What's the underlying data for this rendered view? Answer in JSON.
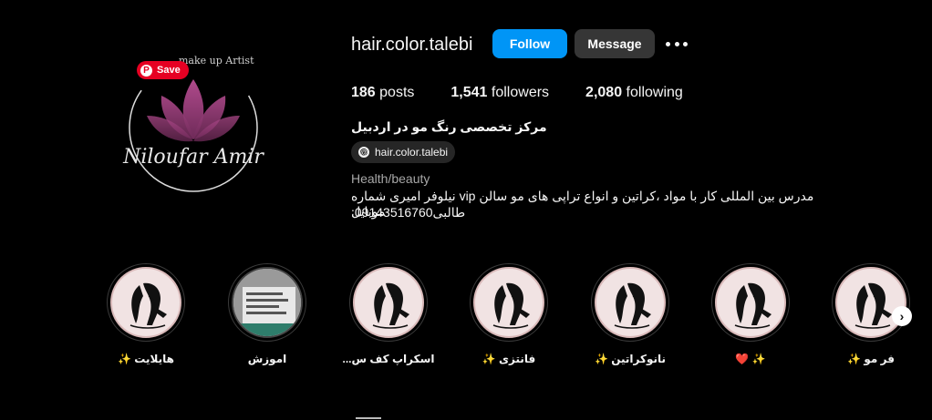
{
  "profile": {
    "username": "hair.color.talebi",
    "follow_label": "Follow",
    "message_label": "Message",
    "avatar": {
      "logo_text": "Niloufar Amir",
      "ring_text": "make up Artist"
    },
    "pin_save_label": "Save",
    "stats": {
      "posts_count": "186",
      "posts_label": "posts",
      "followers_count": "1,541",
      "followers_label": "followers",
      "following_count": "2,080",
      "following_label": "following"
    },
    "full_name": "مرکز تخصصی رنگ مو در اردبیل",
    "threads_handle": "hair.color.talebi",
    "threads_icon": "@",
    "category": "Health/beauty",
    "bio_line1": "مدرس بین المللی کار با مواد ،کراتین و انواع تراپی های مو سالن vip نیلوفر امیری شماره موبایل",
    "bio_line2": "طالبی09143516760:"
  },
  "highlights": [
    {
      "label": "هایلایت ✨"
    },
    {
      "label": "اموزش"
    },
    {
      "label": "اسکراپ کف س..."
    },
    {
      "label": "فانتزی ✨"
    },
    {
      "label": "نانوکراتین ✨"
    },
    {
      "label": "✨ ❤️"
    },
    {
      "label": "فر مو ✨"
    }
  ],
  "colors": {
    "follow": "#0095f6",
    "message": "#363636",
    "pin_save": "#e60023",
    "lotus": "#9c3d7a"
  }
}
